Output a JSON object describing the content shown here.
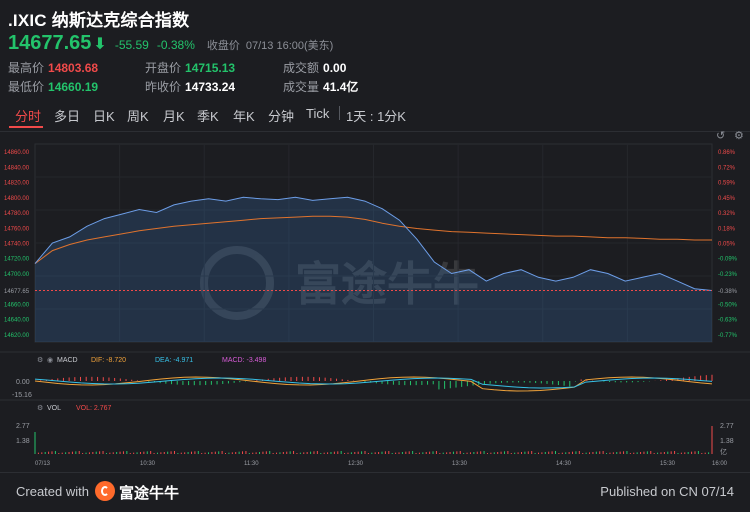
{
  "header": {
    "symbol": ".IXIC 纳斯达克综合指数",
    "price": "14677.65",
    "change": "-55.59",
    "change_pct": "-0.38%",
    "close_label": "收盘价",
    "close_time": "07/13 16:00(美东)",
    "arrow_icon": "down-arrow-icon"
  },
  "stats": {
    "high_label": "最高价",
    "high": "14803.68",
    "low_label": "最低价",
    "low": "14660.19",
    "open_label": "开盘价",
    "open": "14715.13",
    "prev_label": "昨收价",
    "prev": "14733.24",
    "amount_label": "成交额",
    "amount": "0.00",
    "volume_label": "成交量",
    "volume": "41.4亿"
  },
  "tabs": [
    "分时",
    "多日",
    "日K",
    "周K",
    "月K",
    "季K",
    "年K",
    "分钟",
    "Tick"
  ],
  "active_tab": "分时",
  "range_label": "1天 : 1分K",
  "chart": {
    "price_ticks": [
      "14860.00",
      "14840.00",
      "14820.00",
      "14800.00",
      "14780.00",
      "14760.00",
      "14740.00",
      "14720.00",
      "14700.00",
      "14677.65",
      "14660.00",
      "14640.00",
      "14620.00"
    ],
    "pct_ticks": [
      "0.86%",
      "0.72%",
      "0.59%",
      "0.45%",
      "0.32%",
      "0.18%",
      "0.05%",
      "-0.09%",
      "-0.23%",
      "-0.38%",
      "-0.50%",
      "-0.63%",
      "-0.77%"
    ],
    "macd_label": "MACD",
    "dif_label": "DIF: -8.720",
    "dea_label": "DEA: -4.971",
    "macd_val_label": "MACD: -3.498",
    "macd_ticks": [
      "0.00",
      "-15.16"
    ],
    "vol_label": "VOL",
    "vol_val_label": "VOL: 2.767",
    "vol_ticks": [
      "2.77",
      "1.38"
    ],
    "vol_right_ticks": [
      "2.77",
      "1.38",
      "亿"
    ],
    "time_labels": [
      "07/13",
      "10:30",
      "11:30",
      "12:30",
      "13:30",
      "14:30",
      "15:30",
      "16:00"
    ],
    "watermark": "富途牛牛"
  },
  "chart_data": {
    "type": "line",
    "x": [
      "09:30",
      "09:40",
      "09:50",
      "10:00",
      "10:10",
      "10:20",
      "10:30",
      "10:40",
      "10:50",
      "11:00",
      "11:10",
      "11:20",
      "11:30",
      "11:40",
      "11:50",
      "12:00",
      "12:10",
      "12:20",
      "12:30",
      "12:40",
      "12:50",
      "13:00",
      "13:10",
      "13:20",
      "13:30",
      "13:40",
      "13:50",
      "14:00",
      "14:10",
      "14:20",
      "14:30",
      "14:40",
      "14:50",
      "15:00",
      "15:10",
      "15:20",
      "15:30",
      "15:40",
      "15:50",
      "16:00"
    ],
    "series": [
      {
        "values": [
          14713,
          14740,
          14748,
          14762,
          14772,
          14778,
          14784,
          14780,
          14790,
          14795,
          14798,
          14795,
          14800,
          14798,
          14797,
          14800,
          14796,
          14798,
          14800,
          14795,
          14785,
          14770,
          14745,
          14715,
          14700,
          14705,
          14690,
          14700,
          14705,
          14695,
          14690,
          14695,
          14705,
          14700,
          14690,
          14695,
          14700,
          14690,
          14680,
          14677.65
        ]
      },
      {
        "values": [
          14713,
          14730,
          14738,
          14744,
          14748,
          14752,
          14756,
          14759,
          14762,
          14764,
          14766,
          14768,
          14770,
          14772,
          14773,
          14774,
          14775,
          14775,
          14774,
          14771,
          14766,
          14762,
          14759,
          14757,
          14755,
          14754,
          14753,
          14752,
          14751,
          14750,
          14749,
          14749,
          14748,
          14747,
          14747,
          14746,
          14745,
          14745,
          14744,
          14744
        ]
      }
    ],
    "ylim": [
      14610,
      14870
    ],
    "prev_close": 14733.24
  },
  "footer": {
    "created": "Created with",
    "brand": "富途牛牛",
    "published": "Published on CN 07/14"
  }
}
